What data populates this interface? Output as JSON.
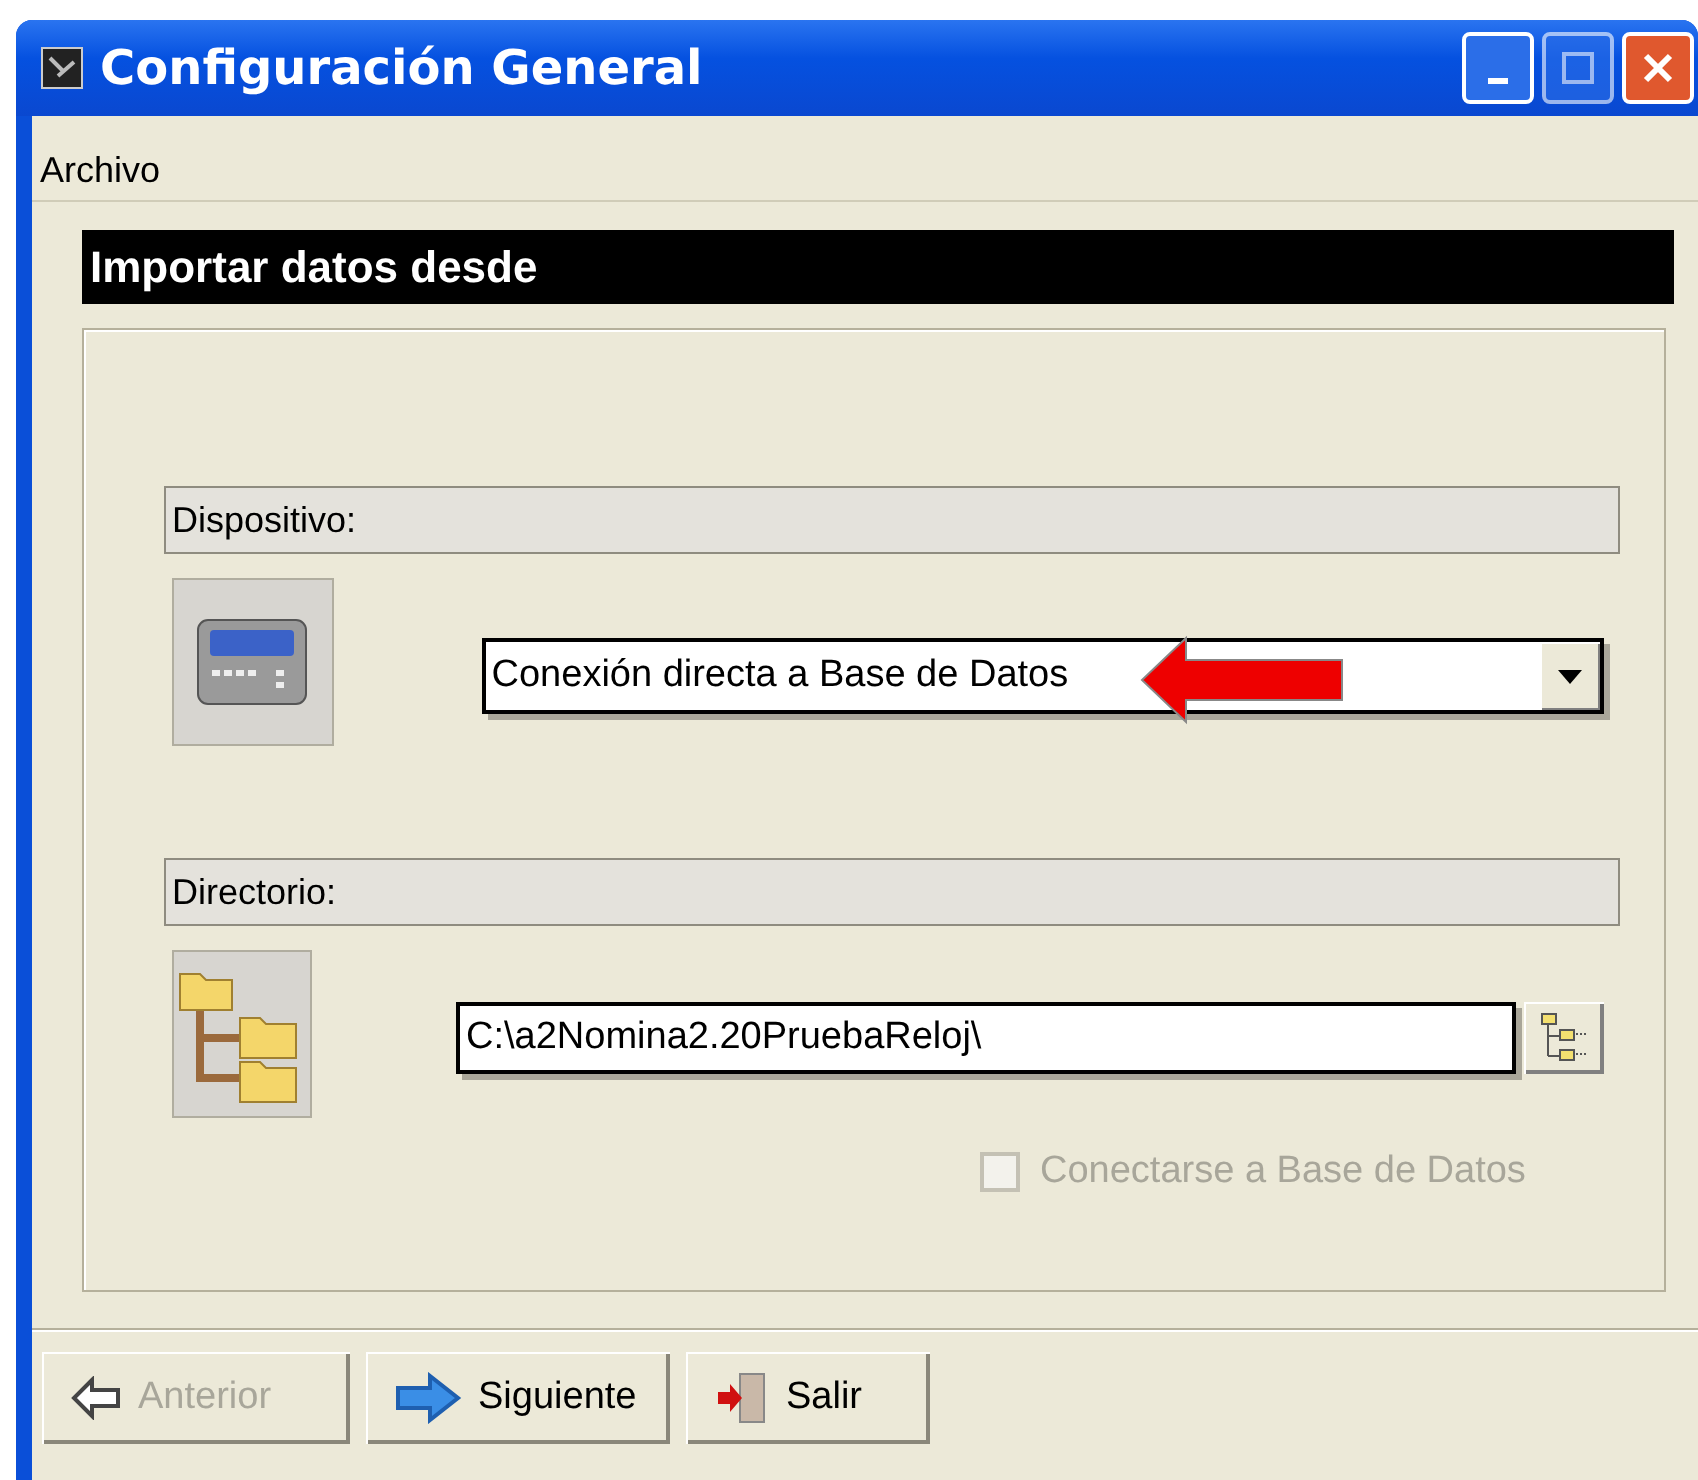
{
  "window": {
    "title": "Configuración General"
  },
  "menu": [
    {
      "label": "Archivo"
    }
  ],
  "section_title": "Importar datos desde",
  "device": {
    "label": "Dispositivo:",
    "value": "Conexión directa a Base de Datos"
  },
  "directory": {
    "label": "Directorio:",
    "value": "C:\\a2Nomina2.20PruebaReloj\\"
  },
  "checkbox": {
    "label": "Conectarse a Base de Datos",
    "checked": false,
    "disabled": true
  },
  "buttons": [
    {
      "label": "Anterior",
      "kind": "back",
      "disabled": true
    },
    {
      "label": "Siguiente",
      "kind": "next",
      "disabled": false
    },
    {
      "label": "Salir",
      "kind": "exit",
      "disabled": false
    }
  ]
}
